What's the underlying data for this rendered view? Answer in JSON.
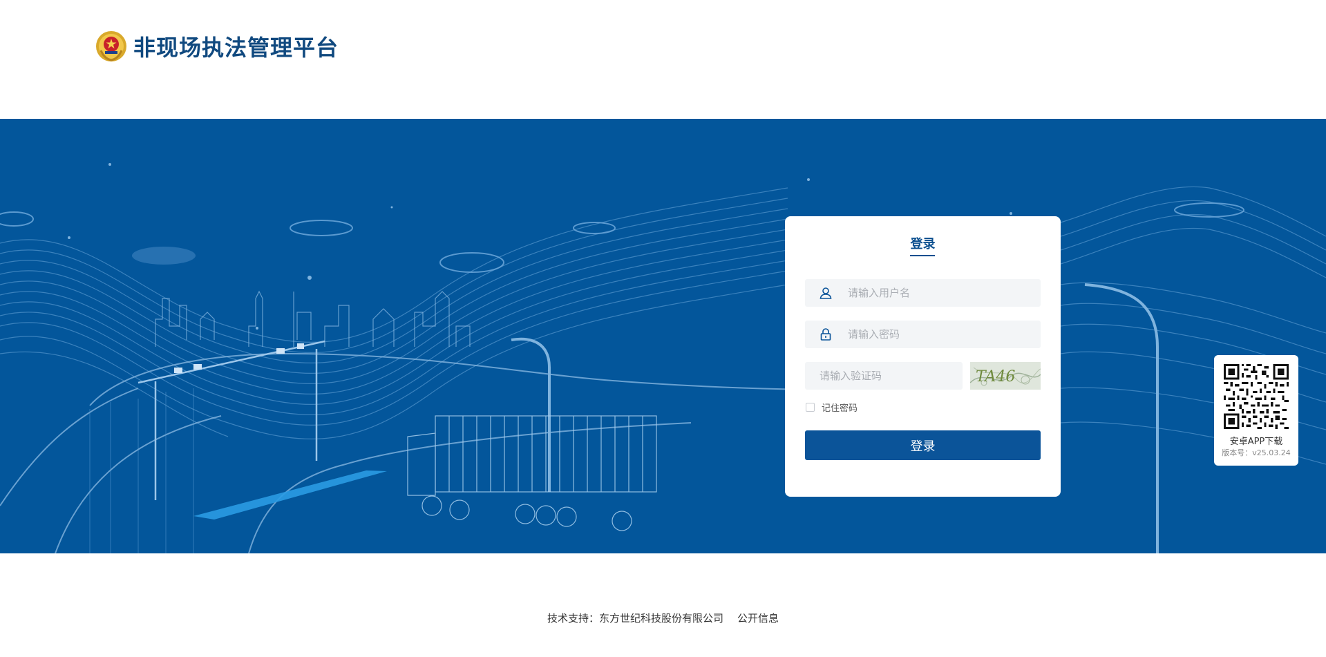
{
  "header": {
    "title": "非现场执法管理平台",
    "emblem_icon": "police-emblem-icon"
  },
  "login": {
    "title": "登录",
    "username_placeholder": "请输入用户名",
    "password_placeholder": "请输入密码",
    "captcha_placeholder": "请输入验证码",
    "captcha_text": "TA46",
    "remember_label": "记住密码",
    "submit_label": "登录",
    "accent_color": "#0b5499"
  },
  "qr": {
    "label": "安卓APP下载",
    "version": "版本号：v25.03.24"
  },
  "footer": {
    "support_text": "技术支持：东方世纪科技股份有限公司",
    "public_info_link": "公开信息"
  },
  "colors": {
    "hero_background": "#03569b",
    "brand_text": "#10497f",
    "button": "#0b5499"
  }
}
